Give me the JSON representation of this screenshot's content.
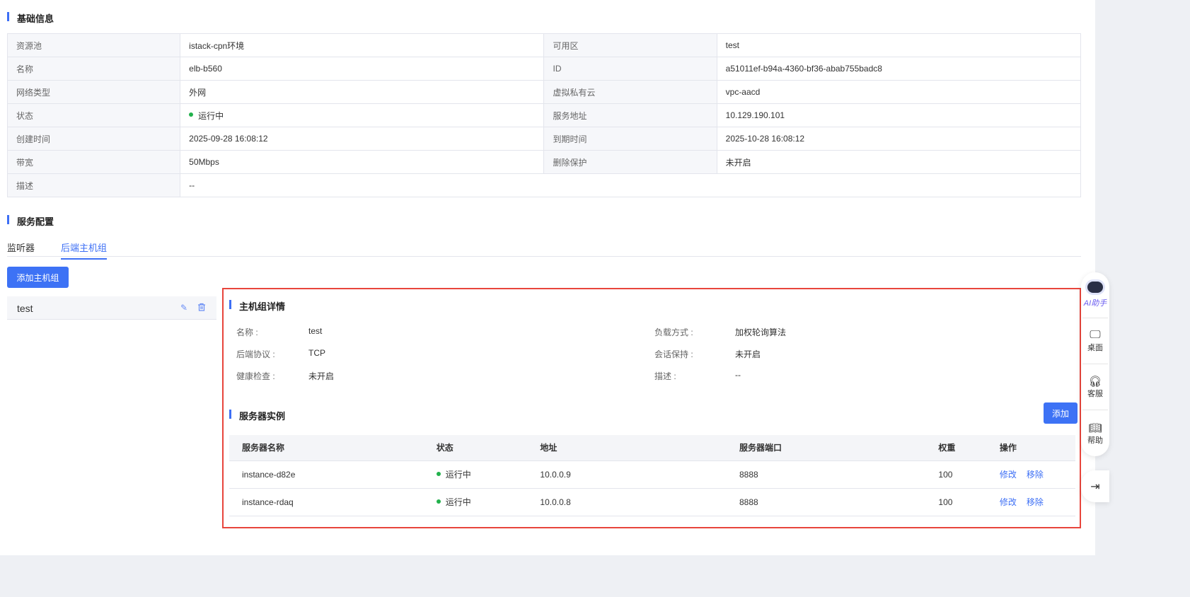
{
  "basic": {
    "title": "基础信息",
    "rows": [
      [
        {
          "l": "资源池",
          "v": "istack-cpn环境"
        },
        {
          "l": "可用区",
          "v": "test"
        }
      ],
      [
        {
          "l": "名称",
          "v": "elb-b560"
        },
        {
          "l": "ID",
          "v": "a51011ef-b94a-4360-bf36-abab755badc8"
        }
      ],
      [
        {
          "l": "网络类型",
          "v": "外网"
        },
        {
          "l": "虚拟私有云",
          "v": "vpc-aacd"
        }
      ],
      [
        {
          "l": "状态",
          "v": "运行中"
        },
        {
          "l": "服务地址",
          "v": "10.129.190.101"
        }
      ],
      [
        {
          "l": "创建时间",
          "v": "2025-09-28 16:08:12"
        },
        {
          "l": "到期时间",
          "v": "2025-10-28 16:08:12"
        }
      ],
      [
        {
          "l": "带宽",
          "v": "50Mbps"
        },
        {
          "l": "删除保护",
          "v": "未开启"
        }
      ]
    ],
    "desc": {
      "l": "描述",
      "v": "--"
    }
  },
  "service": {
    "title": "服务配置",
    "tabs": [
      "监听器",
      "后端主机组"
    ],
    "add_group": "添加主机组",
    "group": "test"
  },
  "detail": {
    "title": "主机组详情",
    "fields": [
      {
        "k": "名称 :",
        "v": "test"
      },
      {
        "k": "负载方式 :",
        "v": "加权轮询算法"
      },
      {
        "k": "后端协议 :",
        "v": "TCP"
      },
      {
        "k": "会话保持 :",
        "v": "未开启"
      },
      {
        "k": "健康检查 :",
        "v": "未开启"
      },
      {
        "k": "描述 :",
        "v": "--"
      }
    ],
    "instances_title": "服务器实例",
    "add": "添加",
    "headers": [
      "服务器名称",
      "状态",
      "地址",
      "服务器端口",
      "权重",
      "操作"
    ],
    "rows": [
      {
        "name": "instance-d82e",
        "status": "运行中",
        "addr": "10.0.0.9",
        "port": "8888",
        "weight": "100"
      },
      {
        "name": "instance-rdaq",
        "status": "运行中",
        "addr": "10.0.0.8",
        "port": "8888",
        "weight": "100"
      }
    ],
    "edit": "修改",
    "remove": "移除"
  },
  "float": {
    "ai": "AI助手",
    "desktop": "桌面",
    "service": "客服",
    "help": "帮助"
  },
  "colors": {
    "accent": "#3d6ff5",
    "running": "#22b14c",
    "highlight": "#e8453c"
  }
}
